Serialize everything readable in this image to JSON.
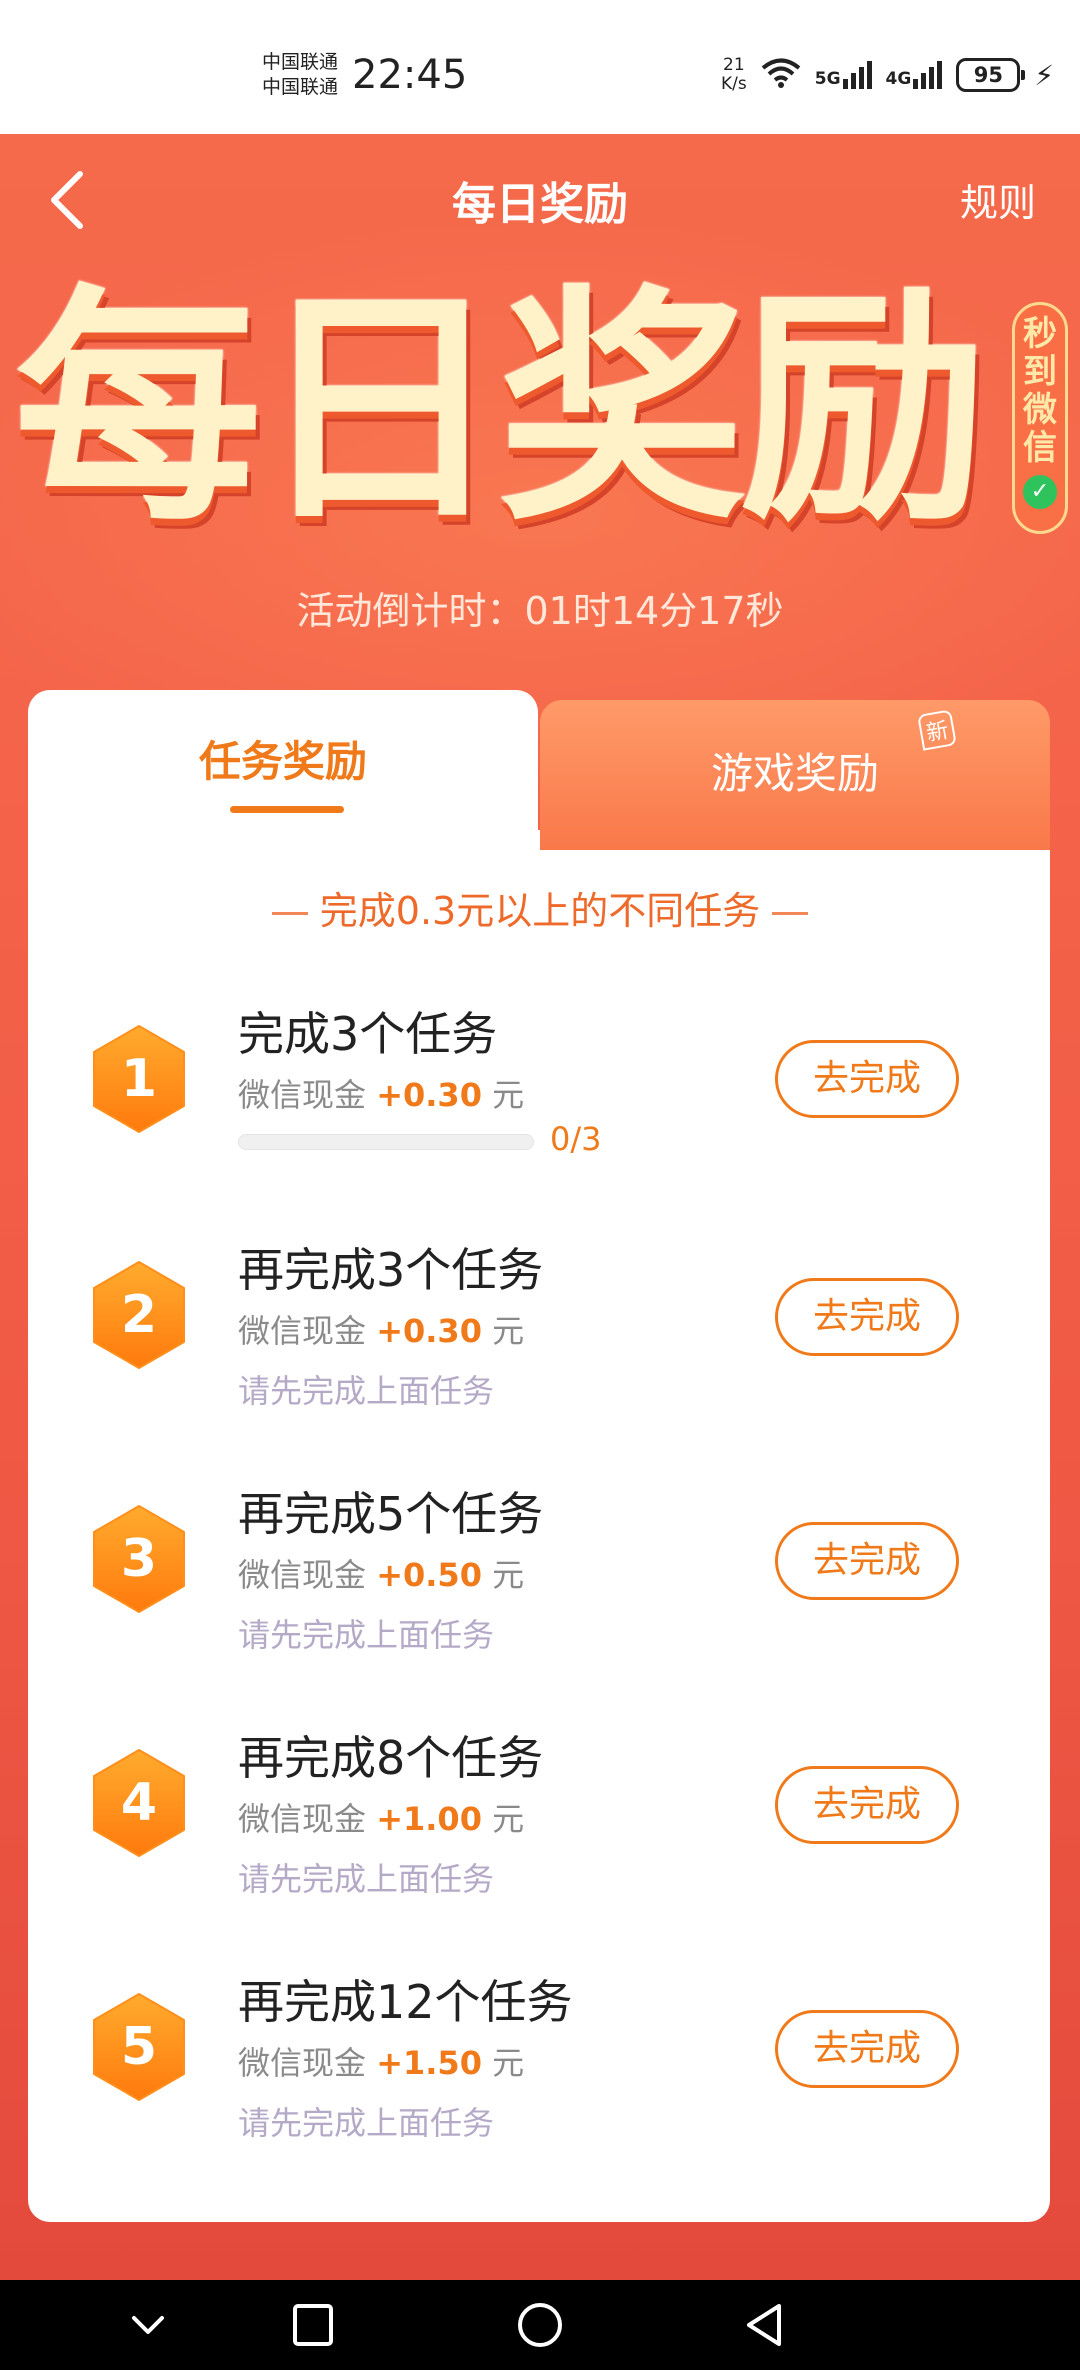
{
  "status_bar": {
    "carrier1": "中国联通",
    "carrier2": "中国联通",
    "time": "22:45",
    "net_speed_value": "21",
    "net_speed_unit": "K/s",
    "sig1_label": "5G",
    "sig2_label": "4G",
    "battery": "95"
  },
  "nav": {
    "title": "每日奖励",
    "rules": "规则"
  },
  "hero": {
    "title": "每日奖励",
    "badge_line1": "秒",
    "badge_line2": "到",
    "badge_line3": "微",
    "badge_line4": "信"
  },
  "countdown": "活动倒计时：01时14分17秒",
  "tabs": {
    "active": "任务奖励",
    "inactive": "游戏奖励",
    "new_badge": "新"
  },
  "subtitle": "完成0.3元以上的不同任务",
  "tasks": [
    {
      "num": "1",
      "title": "完成3个任务",
      "reward_prefix": "微信现金",
      "amount": "+0.30",
      "unit": "元",
      "button": "去完成",
      "progress_text": "0/3",
      "progress": 0
    },
    {
      "num": "2",
      "title": "再完成3个任务",
      "reward_prefix": "微信现金",
      "amount": "+0.30",
      "unit": "元",
      "button": "去完成",
      "hint": "请先完成上面任务"
    },
    {
      "num": "3",
      "title": "再完成5个任务",
      "reward_prefix": "微信现金",
      "amount": "+0.50",
      "unit": "元",
      "button": "去完成",
      "hint": "请先完成上面任务"
    },
    {
      "num": "4",
      "title": "再完成8个任务",
      "reward_prefix": "微信现金",
      "amount": "+1.00",
      "unit": "元",
      "button": "去完成",
      "hint": "请先完成上面任务"
    },
    {
      "num": "5",
      "title": "再完成12个任务",
      "reward_prefix": "微信现金",
      "amount": "+1.50",
      "unit": "元",
      "button": "去完成",
      "hint": "请先完成上面任务"
    }
  ],
  "colors": {
    "accent": "#f07a1a",
    "background": "#f4634a",
    "hex_orange": "#ff8a1a"
  },
  "icons": {
    "back": "back-chevron-icon",
    "check": "check-icon",
    "nav_down": "chevron-down-icon",
    "nav_home": "square-icon",
    "nav_circle": "circle-icon",
    "nav_back": "triangle-back-icon"
  }
}
